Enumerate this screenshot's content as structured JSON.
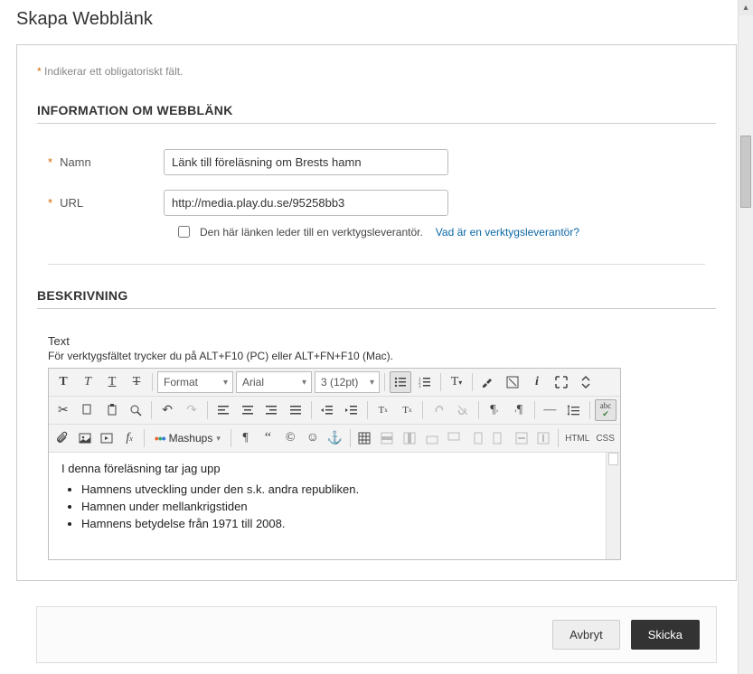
{
  "page": {
    "title": "Skapa Webblänk",
    "required_note": "Indikerar ett obligatoriskt fält."
  },
  "section1": {
    "header": "INFORMATION OM WEBBLÄNK",
    "name_label": "Namn",
    "name_value": "Länk till föreläsning om Brests hamn",
    "url_label": "URL",
    "url_value": "http://media.play.du.se/95258bb3",
    "tool_checkbox_label": "Den här länken leder till en verktygsleverantör.",
    "tool_help_link": "Vad är en verktygsleverantör?"
  },
  "section2": {
    "header": "BESKRIVNING",
    "text_label": "Text",
    "hint": "För verktygsfältet trycker du på ALT+F10 (PC) eller ALT+FN+F10 (Mac)."
  },
  "editor_toolbar": {
    "format": "Format",
    "font": "Arial",
    "size": "3 (12pt)",
    "mashups": "Mashups",
    "html": "HTML",
    "css": "CSS"
  },
  "editor_content": {
    "intro": "I denna föreläsning tar jag upp",
    "bullets": [
      "Hamnens utveckling under den s.k. andra republiken.",
      "Hamnen under mellankrigstiden",
      "Hamnens betydelse från 1971 till 2008."
    ]
  },
  "actions": {
    "cancel": "Avbryt",
    "submit": "Skicka"
  }
}
